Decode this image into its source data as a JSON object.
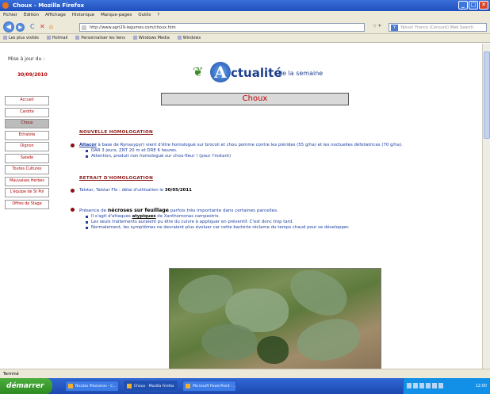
{
  "window": {
    "title": "Choux - Mozilla Firefox",
    "min": "_",
    "max": "□",
    "close": "✕"
  },
  "menu": [
    "Fichier",
    "Édition",
    "Affichage",
    "Historique",
    "Marque-pages",
    "Outils",
    "?"
  ],
  "nav": {
    "back": "◀",
    "forward": "▶",
    "reload": "C",
    "stop": "✕",
    "home": "⌂",
    "url": "http://www.agri29-legumes.com/choux.htm",
    "star": "☆ ▾",
    "search_placeholder": "Yahoo! France (Censuré) Web Search"
  },
  "bookmarks": [
    "Les plus visités",
    "Hotmail",
    "Personnaliser les liens",
    "Windows Media",
    "Windows"
  ],
  "sidebar": {
    "update_label": "Mise à jour du :",
    "update_date": "30/09/2010",
    "items": [
      {
        "label": "Accueil",
        "active": false
      },
      {
        "label": "Carotte",
        "active": false
      },
      {
        "label": "Choux",
        "active": true
      },
      {
        "label": "Echalote",
        "active": false
      },
      {
        "label": "Oignon",
        "active": false
      },
      {
        "label": "Salade",
        "active": false
      },
      {
        "label": "Toutes Cultures",
        "active": false
      },
      {
        "label": "Mauvaises Herbes",
        "active": false
      },
      {
        "label": "L'équipe de St Pol",
        "active": false
      },
      {
        "label": "Offres de Stage",
        "active": false
      }
    ]
  },
  "logo": {
    "letter": "A",
    "word": "ctualité",
    "sub": "de la semaine"
  },
  "page_title": "Choux",
  "sections": {
    "homologation": {
      "heading": "Nouvelle homologation",
      "product": "Altacor",
      "main": " à base de Rynaxypyr) vient d'être homologué sur brocoli et chou pomme contre les piérides (55 g/ha) et les noctuelles défoliatrices (70 g/ha).",
      "subs": [
        "DAR 3 jours, ZNT 20 m et DRE 6 heures.",
        "Attention, produit non homologué sur chou-fleur ! (pour l'instant)"
      ]
    },
    "retrait": {
      "heading": "Retrait d'homologation",
      "text": "Talstar, Talstar Flo : délai d'utilisation le ",
      "date": "30/05/2011"
    },
    "necroses": {
      "pre": "Présence de ",
      "bold": "nécroses sur feuillage",
      "post": " parfois très importante dans certaines parcelles.",
      "sub1_pre": "Il s'agit d'attaques ",
      "sub1_bold": "atypiques",
      "sub1_post": " de Xanthomonas campestris.",
      "subs": [
        "Les seuls traitements auraient pu être du cuivre à appliquer en préventif. C'est donc trop tard.",
        "Normalement, les symptômes ne devraient plus évoluer car cette bactérie réclame du temps chaud pour se développer."
      ]
    }
  },
  "status": "Terminé",
  "taskbar": {
    "start": "démarrer",
    "tasks": [
      "Nicolas Pitoiseron - C...",
      "Choux - Mozilla Firefox",
      "Microsoft PowerPoint - ..."
    ],
    "clock": "12:00"
  }
}
